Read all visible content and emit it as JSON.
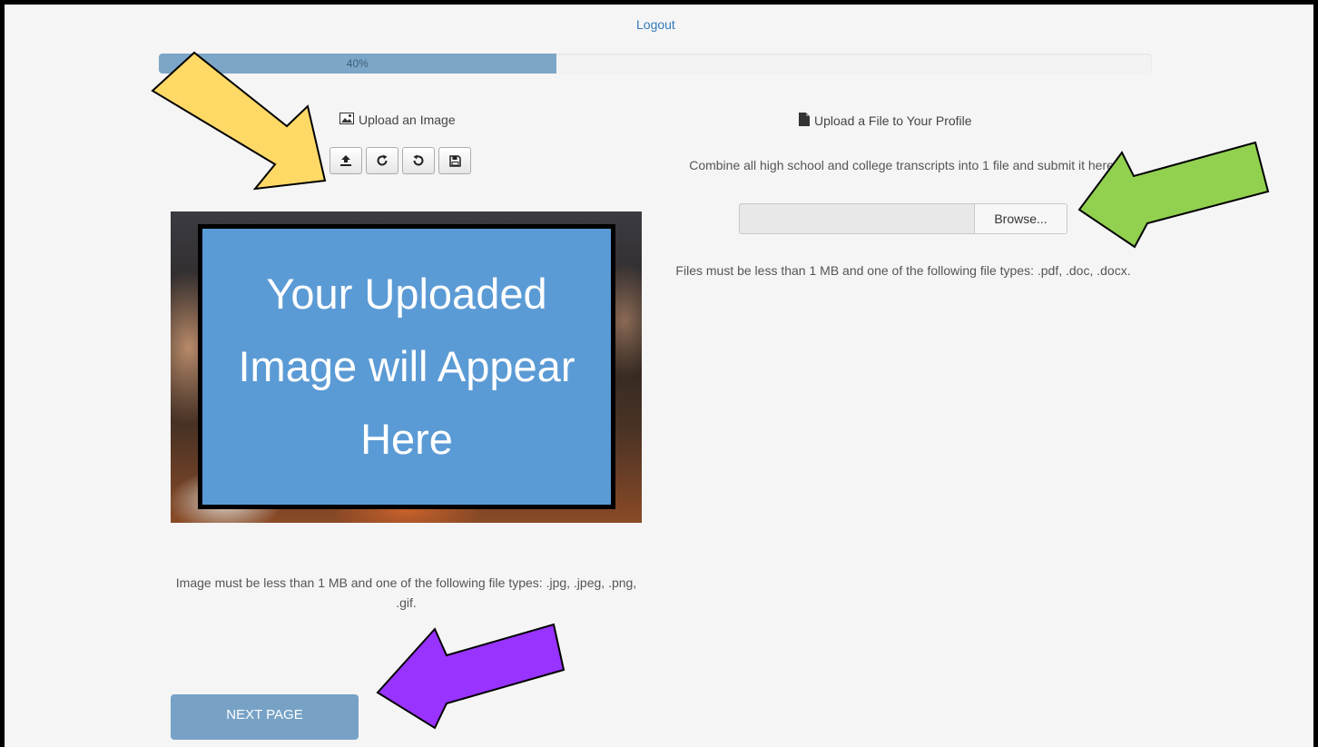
{
  "header": {
    "logout_label": "Logout"
  },
  "progress": {
    "label": "40%",
    "value_percent": 40
  },
  "image_section": {
    "title": "Upload an Image",
    "title_icon": "image-icon",
    "toolbar": [
      {
        "name": "upload-button",
        "icon": "upload-icon"
      },
      {
        "name": "rotate-clockwise-button",
        "icon": "rotate-right-icon"
      },
      {
        "name": "rotate-counterclockwise-button",
        "icon": "rotate-left-icon"
      },
      {
        "name": "save-button",
        "icon": "save-icon"
      }
    ],
    "placeholder_text": "Your Uploaded Image will Appear Here",
    "help_text": "Image must be less than 1 MB and one of the following file types: .jpg, .jpeg, .png, .gif."
  },
  "file_section": {
    "title": "Upload a File to Your Profile",
    "title_icon": "file-icon",
    "instruction": "Combine all high school and college transcripts into 1 file and submit it here.",
    "file_value": "",
    "browse_label": "Browse...",
    "help_text": "Files must be less than 1 MB and one of the following file types: .pdf, .doc, .docx."
  },
  "footer": {
    "next_label": "NEXT PAGE"
  },
  "annotations": {
    "arrow_colors": {
      "yellow": "#ffd966",
      "green": "#92d050",
      "purple": "#9933ff"
    }
  }
}
